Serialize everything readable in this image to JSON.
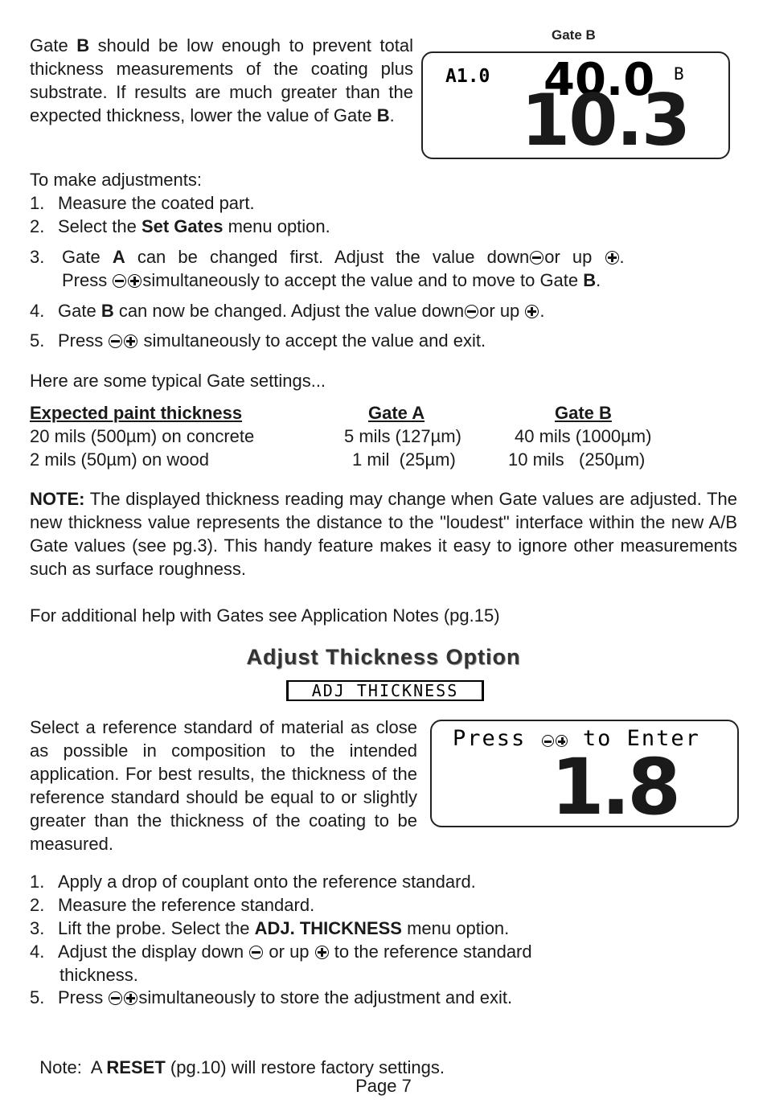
{
  "gate_b_section": {
    "paragraph_parts": [
      "Gate ",
      "B",
      " should be low enough to prevent total thickness measurements of the coating plus substrate. If results are much greater than the expected thickness, lower the value of Gate ",
      "B",
      "."
    ],
    "display_caption": "Gate B",
    "display": {
      "gate_a_label": "A1.0",
      "gate_b_value": "40.0",
      "gate_b_marker": "B",
      "reading": "10.3"
    }
  },
  "adjustments": {
    "intro": "To make adjustments:",
    "steps": [
      {
        "num": "1.",
        "text": "Measure the coated part."
      },
      {
        "num": "2.",
        "pre": "Select the ",
        "bold": "Set Gates",
        "post": " menu option."
      },
      {
        "num": "3.",
        "line1_pre": "Gate ",
        "line1_bold": "A",
        "line1_mid": " can be changed first.  Adjust the value down",
        "line1_or": "or up",
        "line1_end": ".",
        "line2_pre": "Press",
        "line2_post": "simultaneously to accept the value and to move to Gate ",
        "line2_bold": "B",
        "line2_end": "."
      },
      {
        "num": "4.",
        "pre": "Gate ",
        "bold": "B",
        "mid": " can now be changed.  Adjust the value down",
        "or": "or up",
        "end": "."
      },
      {
        "num": "5.",
        "pre": "Press",
        "post": " simultaneously to accept the value and exit."
      }
    ]
  },
  "typical_settings": {
    "intro": "Here are some typical Gate settings...",
    "headers": [
      "Expected paint thickness",
      "Gate A",
      "Gate B"
    ],
    "rows": [
      [
        "20 mils (500µm) on concrete",
        "5 mils (127µm)",
        "40 mils (1000µm)"
      ],
      [
        "2 mils (50µm) on wood",
        "1 mil  (25µm)",
        "10 mils   (250µm)"
      ]
    ]
  },
  "note": {
    "label": "NOTE:",
    "text": " The displayed thickness reading may change when Gate values are adjusted.  The new thickness value represents the distance to the \"loudest\" interface within the new A/B Gate values (see pg.3). This handy feature makes it easy to ignore other measurements such as surface roughness."
  },
  "additional_help": "For additional help with Gates see Application Notes (pg.15)",
  "adjust_thickness": {
    "heading": "Adjust Thickness Option",
    "menu_label": "ADJ THICKNESS",
    "paragraph": "Select a reference standard of material as close as possible in composition to the intended application. For best results, the thickness of the reference standard should be equal to or slightly greater than the thickness of the coating to be measured.",
    "display": {
      "prompt_pre": "Press",
      "prompt_post": "to Enter",
      "reading": "1.8"
    },
    "steps": [
      {
        "num": "1.",
        "text": "Apply a drop of couplant onto the reference standard."
      },
      {
        "num": "2.",
        "text": "Measure the reference standard."
      },
      {
        "num": "3.",
        "pre": "Lift the probe. Select the ",
        "bold": "ADJ. THICKNESS",
        "post": " menu option."
      },
      {
        "num": "4.",
        "pre": "Adjust the display down",
        "or": "or up",
        "post": "to the reference standard",
        "line2": "thickness."
      },
      {
        "num": "5.",
        "pre": "Press",
        "post": "simultaneously to store the adjustment and exit."
      }
    ]
  },
  "footer_note": {
    "pre": "Note:  A ",
    "bold": "RESET",
    "post": " (pg.10) will restore factory settings."
  },
  "page_label": "Page 7",
  "icons": {
    "minus": "minus-button-icon",
    "plus": "plus-button-icon"
  }
}
